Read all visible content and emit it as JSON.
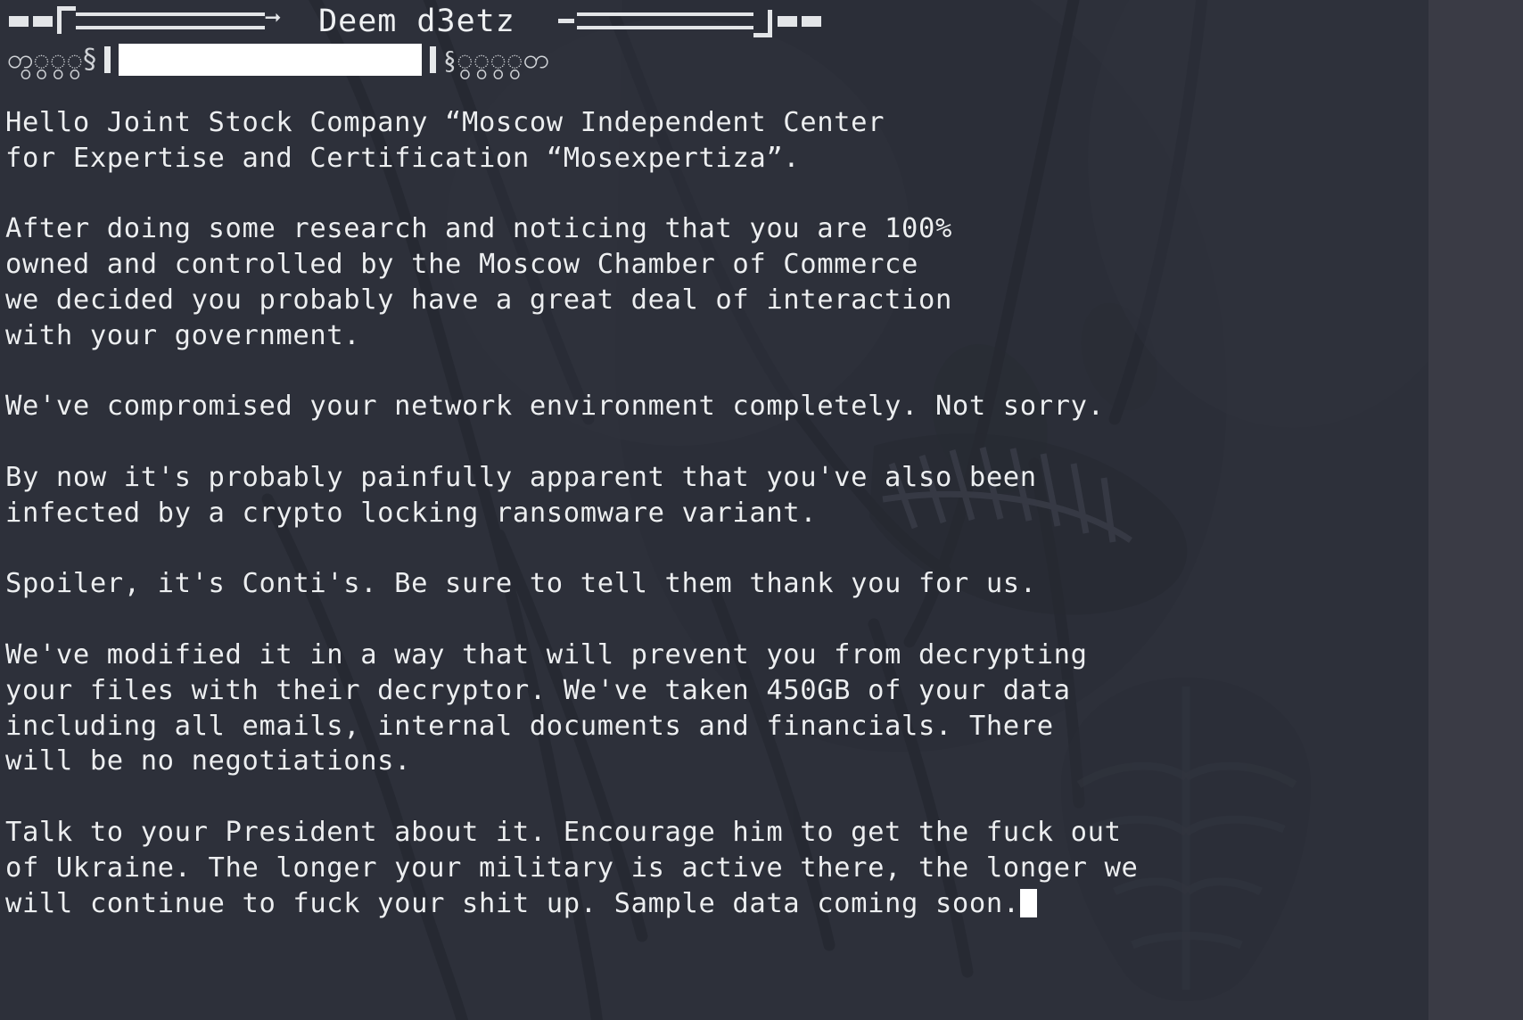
{
  "window": {
    "background_color": "#2d303a",
    "text_color": "#eceef0",
    "gutter_color": "#3a3b45"
  },
  "header": {
    "title": "Deem d3etz",
    "left_decoration": "▬▬l════════→",
    "right_decoration": "-═════════l▬▬",
    "arrow_glyph": "➤",
    "left_glyphs": "တွွွွ§",
    "right_glyphs": "§ွွွွတ",
    "section_sign": "§",
    "input": {
      "value": "",
      "placeholder": ""
    }
  },
  "note": {
    "lines": [
      "Hello Joint Stock Company “Moscow Independent Center",
      "for Expertise and Certification “Mosexpertiza”.",
      "",
      "After doing some research and noticing that you are 100%",
      "owned and controlled by the Moscow Chamber of Commerce",
      "we decided you probably have a great deal of interaction",
      "with your government.",
      "",
      "We've compromised your network environment completely. Not sorry.",
      "",
      "By now it's probably painfully apparent that you've also been",
      "infected by a crypto locking ransomware variant.",
      "",
      "Spoiler, it's Conti's. Be sure to tell them thank you for us.",
      "",
      "We've modified it in a way that will prevent you from decrypting",
      "your files with their decryptor. We've taken 450GB of your data",
      "including all emails, internal documents and financials. There",
      "will be no negotiations.",
      "",
      "Talk to your President about it. Encourage him to get the fuck out",
      "of Ukraine. The longer your military is active there, the longer we",
      "will continue to fuck your shit up. Sample data coming soon."
    ],
    "cursor": "block"
  }
}
